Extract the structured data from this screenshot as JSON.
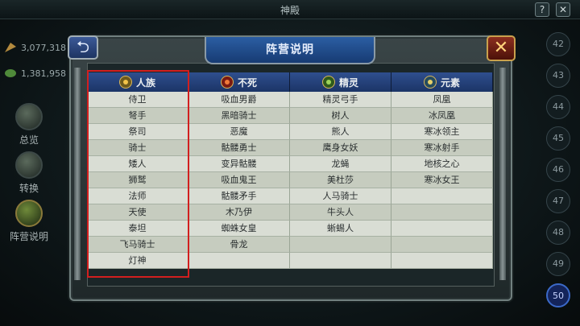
{
  "top_bar": {
    "title": "神殿",
    "help_icon": "?",
    "close_icon": "✕"
  },
  "resources": [
    {
      "icon": "feather-icon",
      "value": "3,077,318"
    },
    {
      "icon": "leaf-icon",
      "value": "1,381,958"
    }
  ],
  "sidebar": [
    {
      "label": "总览",
      "icon": "book-icon"
    },
    {
      "label": "转换",
      "icon": "convert-icon"
    },
    {
      "label": "阵营说明",
      "icon": "tree-icon",
      "active": true
    }
  ],
  "levels": [
    "42",
    "43",
    "44",
    "45",
    "46",
    "47",
    "48",
    "49",
    "50"
  ],
  "current_level": "50",
  "dialog": {
    "title": "阵营说明",
    "back_icon": "back-arrow-icon",
    "close_icon": "close-x-icon"
  },
  "table": {
    "headers": [
      {
        "label": "人族",
        "icon": "human-faction-icon"
      },
      {
        "label": "不死",
        "icon": "undead-faction-icon"
      },
      {
        "label": "精灵",
        "icon": "elf-faction-icon"
      },
      {
        "label": "元素",
        "icon": "element-faction-icon"
      }
    ],
    "rows": [
      [
        "侍卫",
        "吸血男爵",
        "精灵弓手",
        "凤凰"
      ],
      [
        "弩手",
        "黑暗骑士",
        "树人",
        "冰凤凰"
      ],
      [
        "祭司",
        "恶魔",
        "熊人",
        "寒冰领主"
      ],
      [
        "骑士",
        "骷髅勇士",
        "鹰身女妖",
        "寒冰射手"
      ],
      [
        "矮人",
        "变异骷髅",
        "龙蝇",
        "地核之心"
      ],
      [
        "狮鹫",
        "吸血鬼王",
        "美杜莎",
        "寒冰女王"
      ],
      [
        "法师",
        "骷髅矛手",
        "人马骑士",
        ""
      ],
      [
        "天使",
        "木乃伊",
        "牛头人",
        ""
      ],
      [
        "泰坦",
        "蜘蛛女皇",
        "蜥蜴人",
        ""
      ],
      [
        "飞马骑士",
        "骨龙",
        "",
        ""
      ],
      [
        "灯神",
        "",
        "",
        ""
      ]
    ]
  },
  "colors": {
    "highlight": "#d21f1f",
    "header_bg": "#2f4f8e",
    "title_plate": "#2b5ea3"
  }
}
